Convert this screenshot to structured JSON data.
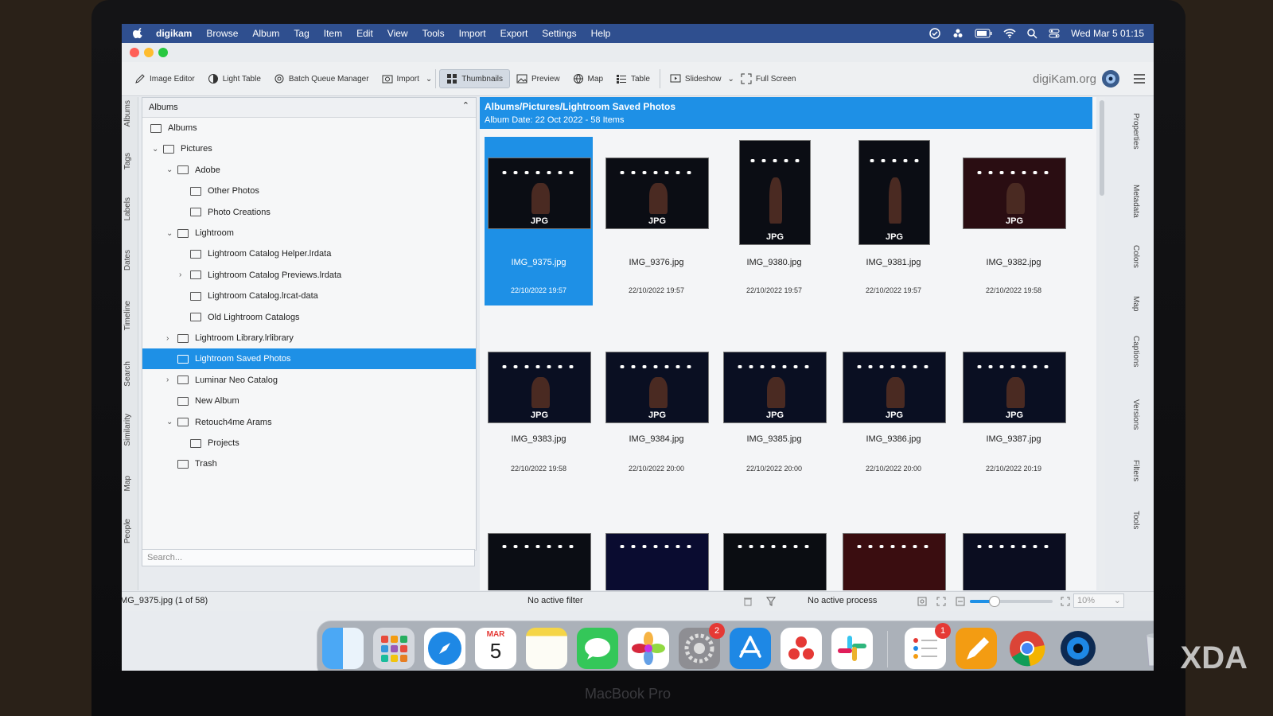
{
  "menubar": {
    "app": "digikam",
    "items": [
      "Browse",
      "Album",
      "Tag",
      "Item",
      "Edit",
      "View",
      "Tools",
      "Import",
      "Export",
      "Settings",
      "Help"
    ],
    "clock": "Wed Mar 5  01:15"
  },
  "toolbar": {
    "image_editor": "Image Editor",
    "light_table": "Light Table",
    "batch_queue": "Batch Queue Manager",
    "import": "Import",
    "thumbnails": "Thumbnails",
    "preview": "Preview",
    "map": "Map",
    "table": "Table",
    "slideshow": "Slideshow",
    "full_screen": "Full Screen",
    "brand": "digiKam.org"
  },
  "left_tabs": [
    "Albums",
    "Tags",
    "Labels",
    "Dates",
    "Timeline",
    "Search",
    "Similarity",
    "Map",
    "People"
  ],
  "right_tabs": [
    "Properties",
    "Metadata",
    "Colors",
    "Map",
    "Captions",
    "Versions",
    "Filters",
    "Tools"
  ],
  "albums_panel": {
    "header": "Albums",
    "tree": [
      {
        "label": "Albums",
        "depth": 0,
        "caret": ""
      },
      {
        "label": "Pictures",
        "depth": 1,
        "caret": "v"
      },
      {
        "label": "Adobe",
        "depth": 2,
        "caret": "v"
      },
      {
        "label": "Other Photos",
        "depth": 3,
        "caret": ""
      },
      {
        "label": "Photo Creations",
        "depth": 3,
        "caret": ""
      },
      {
        "label": "Lightroom",
        "depth": 2,
        "caret": "v"
      },
      {
        "label": "Lightroom Catalog Helper.lrdata",
        "depth": 3,
        "caret": ""
      },
      {
        "label": "Lightroom Catalog Previews.lrdata",
        "depth": 3,
        "caret": ">"
      },
      {
        "label": "Lightroom Catalog.lrcat-data",
        "depth": 3,
        "caret": ""
      },
      {
        "label": "Old Lightroom Catalogs",
        "depth": 3,
        "caret": ""
      },
      {
        "label": "Lightroom Library.lrlibrary",
        "depth": 2,
        "caret": ">"
      },
      {
        "label": "Lightroom Saved Photos",
        "depth": 2,
        "caret": "",
        "selected": true
      },
      {
        "label": "Luminar Neo Catalog",
        "depth": 2,
        "caret": ">"
      },
      {
        "label": "New Album",
        "depth": 2,
        "caret": ""
      },
      {
        "label": "Retouch4me Arams",
        "depth": 2,
        "caret": "v"
      },
      {
        "label": "Projects",
        "depth": 3,
        "caret": ""
      },
      {
        "label": "Trash",
        "depth": 2,
        "caret": ""
      }
    ],
    "search_placeholder": "Search..."
  },
  "main": {
    "path": "Albums/Pictures/Lightroom Saved Photos",
    "subtitle": "Album Date: 22 Oct 2022 - 58 Items",
    "badge": "JPG",
    "thumbnails": [
      {
        "name": "IMG_9375.jpg",
        "date": "22/10/2022 19:57",
        "selected": true,
        "orient": "l"
      },
      {
        "name": "IMG_9376.jpg",
        "date": "22/10/2022 19:57",
        "orient": "l"
      },
      {
        "name": "IMG_9380.jpg",
        "date": "22/10/2022 19:57",
        "orient": "p"
      },
      {
        "name": "IMG_9381.jpg",
        "date": "22/10/2022 19:57",
        "orient": "p"
      },
      {
        "name": "IMG_9382.jpg",
        "date": "22/10/2022 19:58",
        "orient": "l"
      },
      {
        "name": "IMG_9383.jpg",
        "date": "22/10/2022 19:58",
        "orient": "l"
      },
      {
        "name": "IMG_9384.jpg",
        "date": "22/10/2022 20:00",
        "orient": "l"
      },
      {
        "name": "IMG_9385.jpg",
        "date": "22/10/2022 20:00",
        "orient": "l"
      },
      {
        "name": "IMG_9386.jpg",
        "date": "22/10/2022 20:00",
        "orient": "l"
      },
      {
        "name": "IMG_9387.jpg",
        "date": "22/10/2022 20:19",
        "orient": "l"
      }
    ]
  },
  "status": {
    "left": "IMG_9375.jpg (1 of 58)",
    "filter": "No active filter",
    "process": "No active process",
    "zoom": "10%",
    "zoom_level": 0.1
  },
  "dock": {
    "calendar_month": "MAR",
    "calendar_day": "5",
    "settings_badge": "2",
    "reminders_badge": "1"
  },
  "bezel_label": "MacBook Pro",
  "watermark": "XDA"
}
